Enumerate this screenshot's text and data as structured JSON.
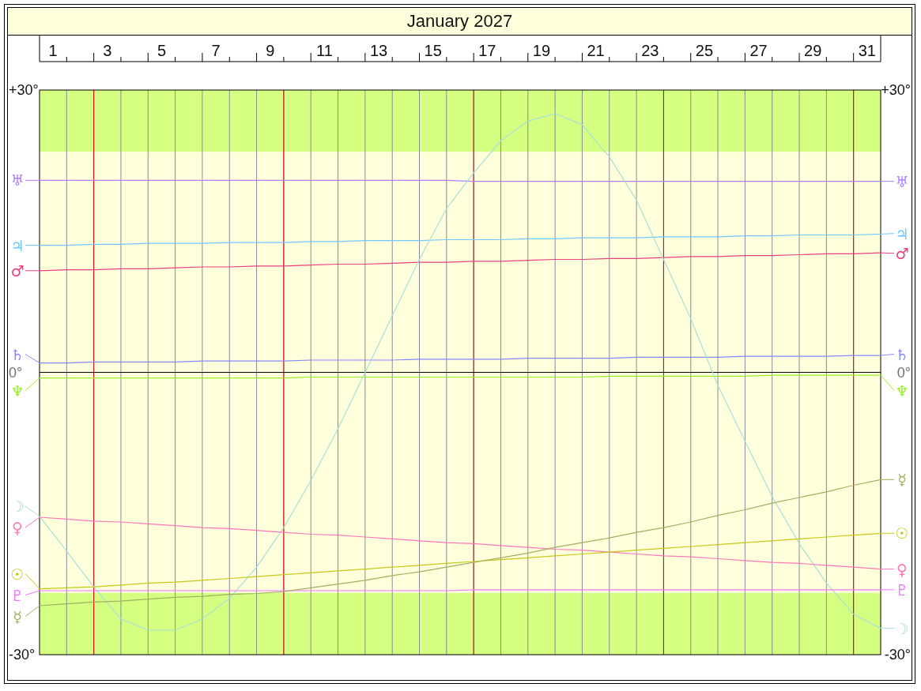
{
  "title": "January 2027",
  "chart": {
    "right_axis_labels": [
      "+30°",
      "0°",
      "-30°"
    ],
    "right_glyphs": [
      "♅",
      "♃",
      "♂",
      "♄",
      "♆",
      "☿",
      "☉",
      "♀",
      "♇",
      "☽"
    ],
    "chart_data": {
      "type": "line",
      "xlim": [
        1,
        32
      ],
      "ylim": [
        -30,
        30
      ],
      "legend": "left",
      "yticks": [
        {
          "value": 30,
          "label": "+30°"
        },
        {
          "value": 0,
          "label": "0°"
        },
        {
          "value": -30,
          "label": "-30°"
        }
      ],
      "bands": [
        {
          "axis": "y",
          "from": 23.44,
          "to": 30,
          "color": "#d4ff80"
        },
        {
          "axis": "y",
          "from": -30,
          "to": -23.44,
          "color": "#d4ff80"
        }
      ],
      "x": [
        1,
        2,
        3,
        4,
        5,
        6,
        7,
        8,
        9,
        10,
        11,
        12,
        13,
        14,
        15,
        16,
        17,
        18,
        19,
        20,
        21,
        22,
        23,
        24,
        25,
        26,
        27,
        28,
        29,
        30,
        31,
        32
      ],
      "xticks": [
        {
          "value": 1.5,
          "label": "1"
        },
        {
          "value": 3.5,
          "label": "3"
        },
        {
          "value": 5.5,
          "label": "5"
        },
        {
          "value": 7.5,
          "label": "7"
        },
        {
          "value": 9.5,
          "label": "9"
        },
        {
          "value": 11.5,
          "label": "11"
        },
        {
          "value": 13.5,
          "label": "13"
        },
        {
          "value": 15.5,
          "label": "15"
        },
        {
          "value": 17.5,
          "label": "17"
        },
        {
          "value": 19.5,
          "label": "19"
        },
        {
          "value": 21.5,
          "label": "21"
        },
        {
          "value": 23.5,
          "label": "23"
        },
        {
          "value": 25.5,
          "label": "25"
        },
        {
          "value": 27.5,
          "label": "27"
        },
        {
          "value": 29.5,
          "label": "29"
        },
        {
          "value": 31.5,
          "label": "31"
        }
      ],
      "ref_lines": [
        {
          "axis": "x",
          "value": 3,
          "color": "#e00000"
        },
        {
          "axis": "x",
          "value": 10,
          "color": "#e00000"
        },
        {
          "axis": "x",
          "value": 17,
          "color": "#e00000"
        },
        {
          "axis": "x",
          "value": 24,
          "color": "#e00000"
        },
        {
          "axis": "x",
          "value": 31,
          "color": "#e00000"
        }
      ],
      "series": [
        {
          "name": "♅",
          "color": "#b080ff",
          "values": [
            20.4,
            20.4,
            20.4,
            20.4,
            20.4,
            20.4,
            20.4,
            20.4,
            20.4,
            20.4,
            20.4,
            20.4,
            20.4,
            20.4,
            20.4,
            20.4,
            20.3,
            20.3,
            20.3,
            20.3,
            20.3,
            20.3,
            20.3,
            20.3,
            20.3,
            20.3,
            20.3,
            20.3,
            20.3,
            20.3,
            20.3,
            20.3
          ]
        },
        {
          "name": "♃",
          "color": "#70c8ff",
          "values": [
            13.5,
            13.5,
            13.6,
            13.6,
            13.7,
            13.7,
            13.7,
            13.8,
            13.8,
            13.8,
            13.9,
            13.9,
            14.0,
            14.0,
            14.0,
            14.1,
            14.1,
            14.1,
            14.2,
            14.2,
            14.3,
            14.3,
            14.3,
            14.4,
            14.4,
            14.4,
            14.5,
            14.5,
            14.6,
            14.6,
            14.6,
            14.7
          ]
        },
        {
          "name": "♂",
          "color": "#e84080",
          "values": [
            10.8,
            10.9,
            10.9,
            11.0,
            11.0,
            11.1,
            11.2,
            11.2,
            11.3,
            11.3,
            11.4,
            11.5,
            11.5,
            11.6,
            11.7,
            11.7,
            11.8,
            11.8,
            11.9,
            12.0,
            12.0,
            12.1,
            12.1,
            12.2,
            12.3,
            12.3,
            12.4,
            12.4,
            12.5,
            12.6,
            12.6,
            12.7
          ]
        },
        {
          "name": "♄",
          "color": "#8888ff",
          "values": [
            1.0,
            1.0,
            1.1,
            1.1,
            1.1,
            1.1,
            1.2,
            1.2,
            1.2,
            1.2,
            1.3,
            1.3,
            1.3,
            1.3,
            1.4,
            1.4,
            1.4,
            1.4,
            1.5,
            1.5,
            1.5,
            1.5,
            1.6,
            1.6,
            1.6,
            1.6,
            1.7,
            1.7,
            1.7,
            1.7,
            1.8,
            1.8
          ]
        },
        {
          "name": "♆",
          "color": "#99ee22",
          "values": [
            -0.6,
            -0.6,
            -0.6,
            -0.6,
            -0.6,
            -0.6,
            -0.6,
            -0.6,
            -0.6,
            -0.6,
            -0.5,
            -0.5,
            -0.5,
            -0.5,
            -0.5,
            -0.5,
            -0.5,
            -0.5,
            -0.5,
            -0.5,
            -0.5,
            -0.4,
            -0.4,
            -0.4,
            -0.4,
            -0.4,
            -0.4,
            -0.3,
            -0.3,
            -0.3,
            -0.3,
            -0.3
          ]
        },
        {
          "name": "☽",
          "color": "#a8e0d8",
          "values": [
            -15.3,
            -19.0,
            -22.8,
            -26.2,
            -27.4,
            -27.4,
            -26.2,
            -24.0,
            -20.7,
            -16.5,
            -11.5,
            -6.0,
            0.0,
            6.0,
            12.0,
            17.4,
            21.2,
            24.6,
            26.7,
            27.5,
            26.3,
            22.9,
            18.3,
            12.0,
            5.7,
            -1.4,
            -7.3,
            -13.2,
            -18.2,
            -22.4,
            -25.7,
            -27.2
          ]
        },
        {
          "name": "♀",
          "color": "#ff77bb",
          "values": [
            -15.4,
            -15.6,
            -15.8,
            -15.9,
            -16.1,
            -16.3,
            -16.5,
            -16.6,
            -16.8,
            -17.0,
            -17.2,
            -17.3,
            -17.5,
            -17.7,
            -17.9,
            -18.1,
            -18.2,
            -18.4,
            -18.6,
            -18.8,
            -18.9,
            -19.1,
            -19.3,
            -19.5,
            -19.6,
            -19.8,
            -20.0,
            -20.2,
            -20.3,
            -20.5,
            -20.7,
            -20.9
          ]
        },
        {
          "name": "☉",
          "color": "#c8c818",
          "values": [
            -23.0,
            -22.9,
            -22.8,
            -22.6,
            -22.4,
            -22.3,
            -22.1,
            -21.9,
            -21.7,
            -21.5,
            -21.3,
            -21.1,
            -20.9,
            -20.7,
            -20.5,
            -20.3,
            -20.1,
            -19.9,
            -19.7,
            -19.5,
            -19.3,
            -19.1,
            -18.9,
            -18.7,
            -18.5,
            -18.3,
            -18.1,
            -17.9,
            -17.7,
            -17.5,
            -17.3,
            -17.1
          ]
        },
        {
          "name": "♇",
          "color": "#ee77ff",
          "values": [
            -23.2,
            -23.2,
            -23.2,
            -23.2,
            -23.2,
            -23.2,
            -23.2,
            -23.2,
            -23.2,
            -23.2,
            -23.2,
            -23.2,
            -23.2,
            -23.2,
            -23.2,
            -23.2,
            -23.1,
            -23.1,
            -23.1,
            -23.1,
            -23.1,
            -23.1,
            -23.1,
            -23.1,
            -23.1,
            -23.1,
            -23.1,
            -23.1,
            -23.1,
            -23.1,
            -23.1,
            -23.1
          ]
        },
        {
          "name": "☿",
          "color": "#a0b060",
          "values": [
            -24.8,
            -24.6,
            -24.4,
            -24.3,
            -24.1,
            -23.9,
            -23.8,
            -23.6,
            -23.5,
            -23.3,
            -22.9,
            -22.5,
            -22.1,
            -21.6,
            -21.2,
            -20.7,
            -20.2,
            -19.7,
            -19.2,
            -18.6,
            -18.1,
            -17.6,
            -17.0,
            -16.5,
            -15.9,
            -15.2,
            -14.6,
            -13.9,
            -13.3,
            -12.7,
            -12.0,
            -11.4
          ]
        }
      ]
    }
  }
}
